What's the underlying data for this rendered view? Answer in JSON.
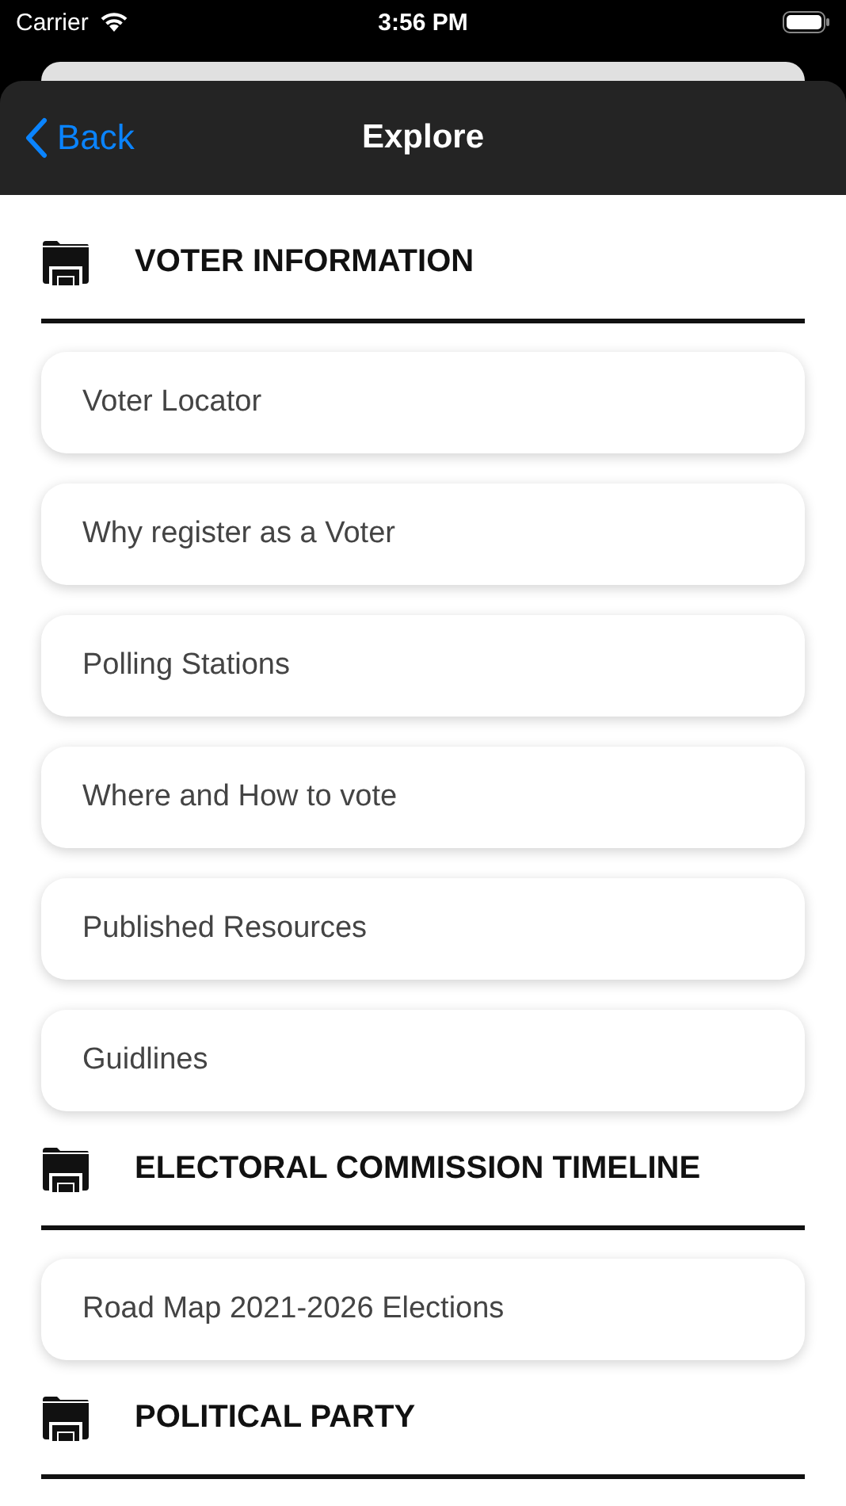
{
  "status_bar": {
    "carrier": "Carrier",
    "time": "3:56 PM"
  },
  "nav": {
    "back": "Back",
    "title": "Explore"
  },
  "sections": [
    {
      "title": "VOTER INFORMATION",
      "items": [
        "Voter Locator",
        "Why register as a Voter",
        "Polling Stations",
        "Where and How to vote",
        "Published Resources",
        "Guidlines"
      ]
    },
    {
      "title": "ELECTORAL COMMISSION TIMELINE",
      "items": [
        "Road Map 2021-2026 Elections"
      ]
    },
    {
      "title": "POLITICAL PARTY"
    }
  ]
}
